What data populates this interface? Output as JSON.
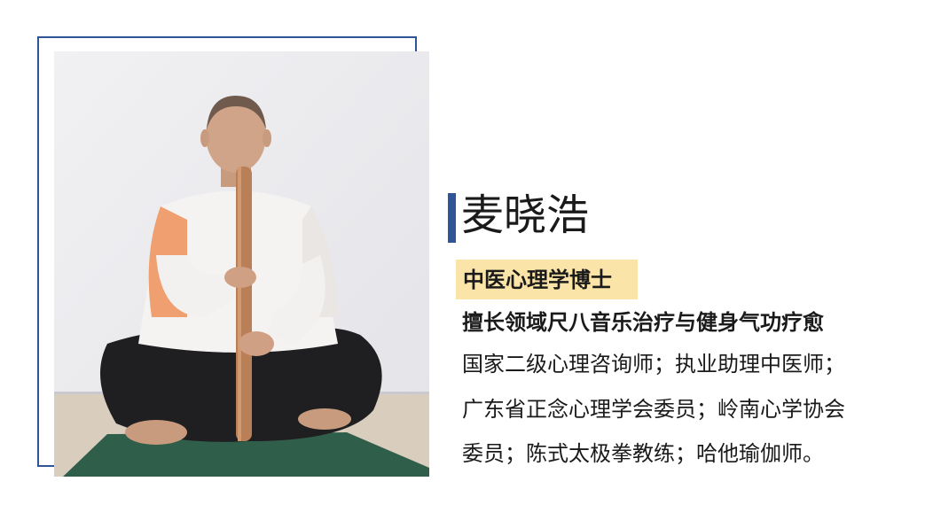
{
  "profile": {
    "name": "麦晓浩",
    "title": "中医心理学博士",
    "specialty": "擅长领域尺八音乐治疗与健身气功疗愈",
    "credentials": [
      "国家二级心理咨询师；执业助理中医师；",
      "广东省正念心理学会委员；岭南心学协会",
      "委员；陈式太极拳教练；哈他瑜伽师。"
    ]
  },
  "colors": {
    "accent_blue": "#2f5597",
    "badge_fill": "#fbe4a8"
  },
  "photo": {
    "subject": "man-seated-cross-legged-playing-shakuhachi"
  }
}
